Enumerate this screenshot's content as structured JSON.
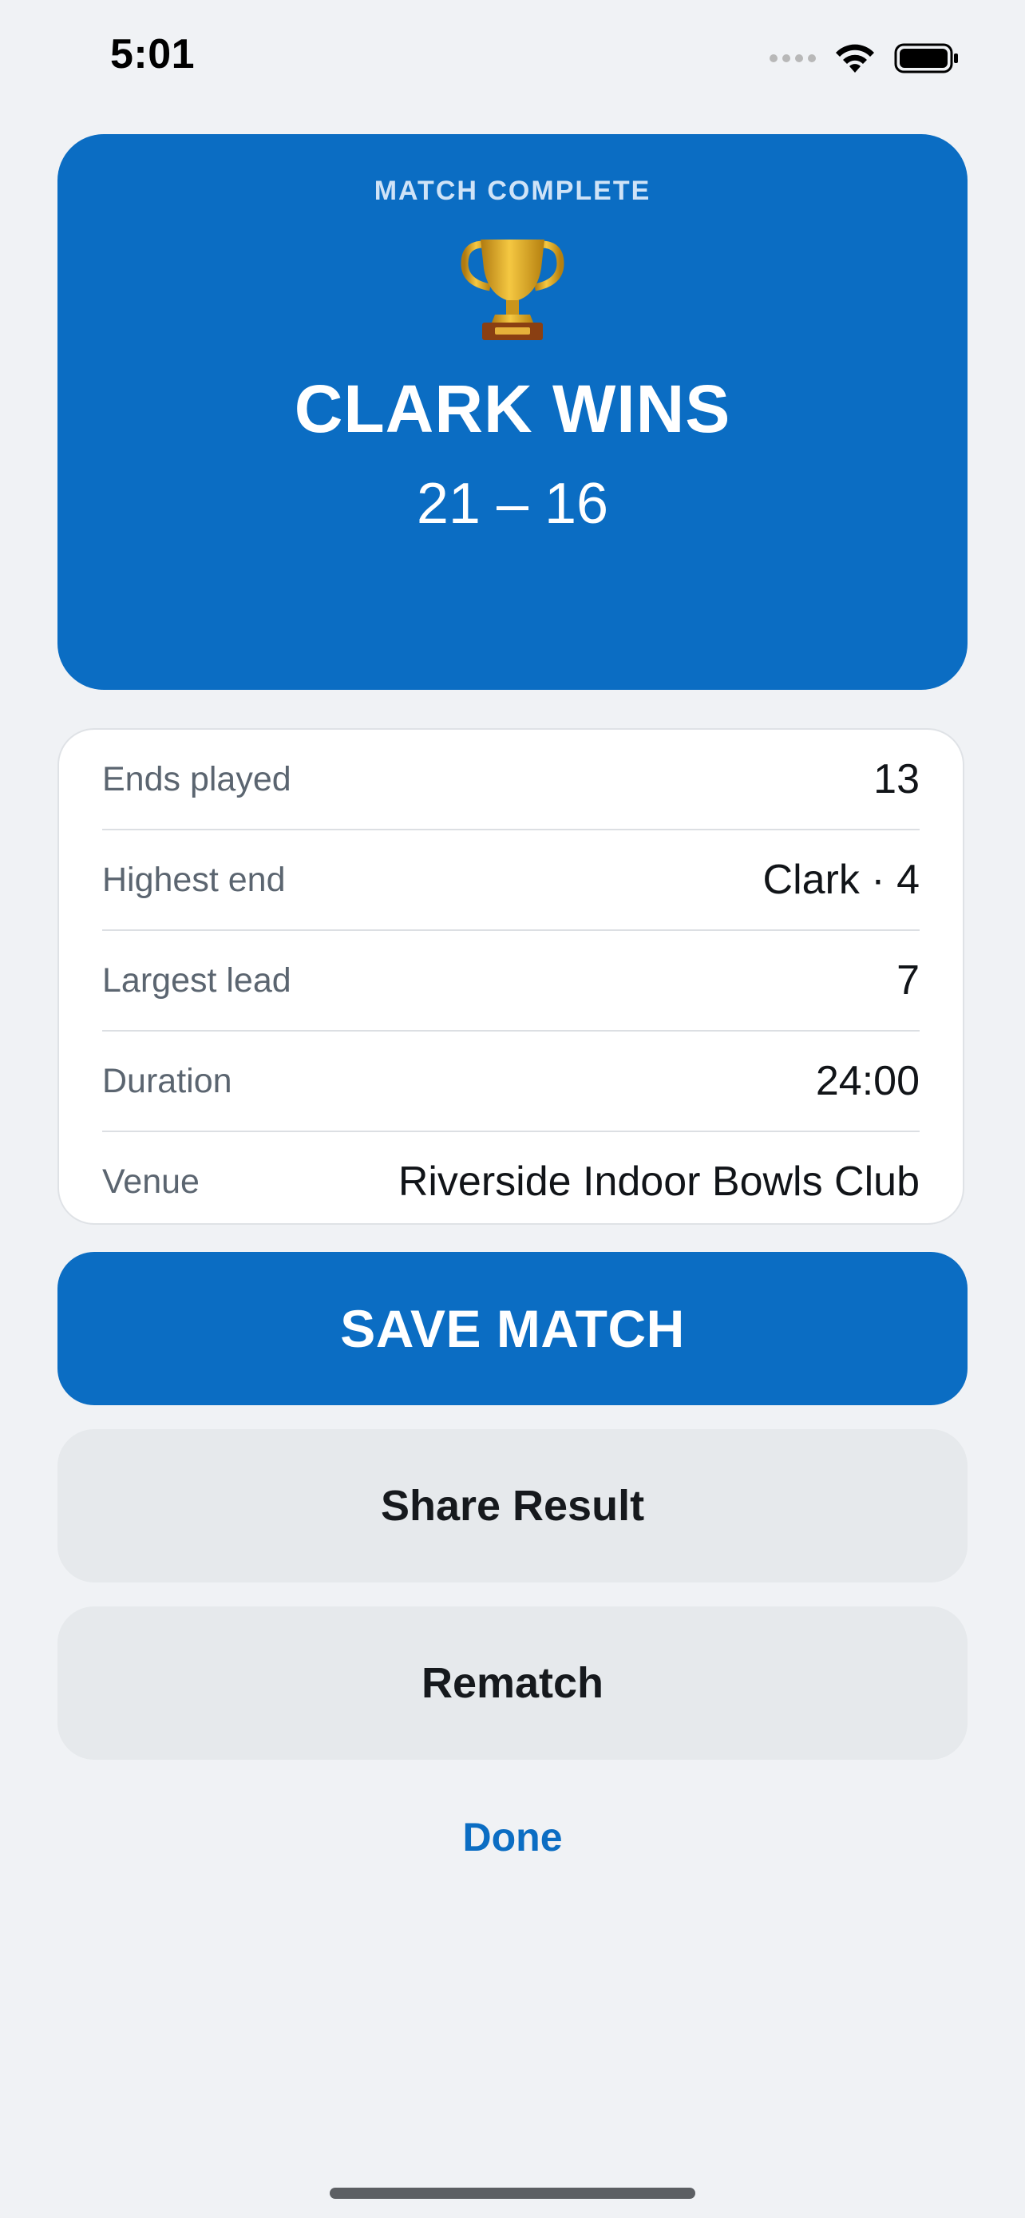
{
  "status_bar": {
    "time": "5:01",
    "icons": [
      "cellular-dots-icon",
      "wifi-icon",
      "battery-icon"
    ]
  },
  "header": {
    "kicker": "MATCH COMPLETE",
    "icon": "trophy-icon",
    "title": "CLARK WINS",
    "score": "21 – 16"
  },
  "stats": {
    "rows": [
      {
        "label": "Ends played",
        "value": "13"
      },
      {
        "label": "Highest end",
        "value": "Clark · 4"
      },
      {
        "label": "Largest lead",
        "value": "7"
      },
      {
        "label": "Duration",
        "value": "24:00"
      },
      {
        "label": "Venue",
        "value": "Riverside Indoor Bowls Club"
      }
    ]
  },
  "actions": {
    "save_label": "SAVE MATCH",
    "share_label": "Share Result",
    "rematch_label": "Rematch",
    "done_label": "Done"
  },
  "colors": {
    "accent": "#0b6dc3",
    "background": "#f0f2f5",
    "secondary_button": "#e6e9ec"
  }
}
